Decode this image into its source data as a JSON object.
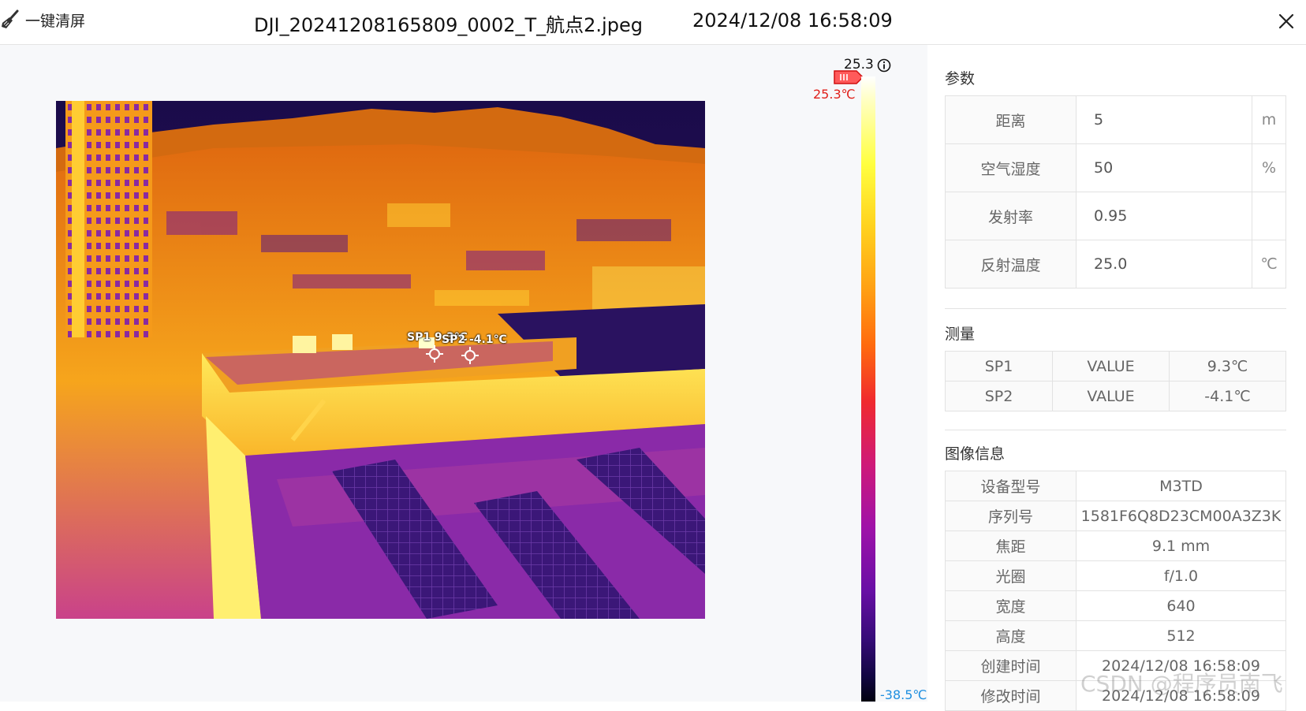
{
  "toolbar": {
    "clear_label": "一键清屏",
    "file_name": "DJI_20241208165809_0002_T_航点2.jpeg",
    "datetime": "2024/12/08 16:58:09"
  },
  "scale": {
    "top_value": "25.3",
    "high_label": "25.3℃",
    "low_label": "-38.5℃"
  },
  "spots": [
    {
      "label": "SP1 9.3℃"
    },
    {
      "label": "SP2 -4.1℃"
    }
  ],
  "params": {
    "title": "参数",
    "rows": [
      {
        "label": "距离",
        "value": "5",
        "unit": "m"
      },
      {
        "label": "空气湿度",
        "value": "50",
        "unit": "%"
      },
      {
        "label": "发射率",
        "value": "0.95",
        "unit": ""
      },
      {
        "label": "反射温度",
        "value": "25.0",
        "unit": "℃"
      }
    ]
  },
  "measure": {
    "title": "测量",
    "rows": [
      {
        "name": "SP1",
        "type": "VALUE",
        "value": "9.3℃"
      },
      {
        "name": "SP2",
        "type": "VALUE",
        "value": "-4.1℃"
      }
    ]
  },
  "image_info": {
    "title": "图像信息",
    "rows": [
      {
        "label": "设备型号",
        "value": "M3TD"
      },
      {
        "label": "序列号",
        "value": "1581F6Q8D23CM00A3Z3K"
      },
      {
        "label": "焦距",
        "value": "9.1 mm"
      },
      {
        "label": "光圈",
        "value": "f/1.0"
      },
      {
        "label": "宽度",
        "value": "640"
      },
      {
        "label": "高度",
        "value": "512"
      },
      {
        "label": "创建时间",
        "value": "2024/12/08 16:58:09"
      },
      {
        "label": "修改时间",
        "value": "2024/12/08 16:58:09"
      }
    ]
  },
  "watermark": "CSDN @程序员南飞"
}
